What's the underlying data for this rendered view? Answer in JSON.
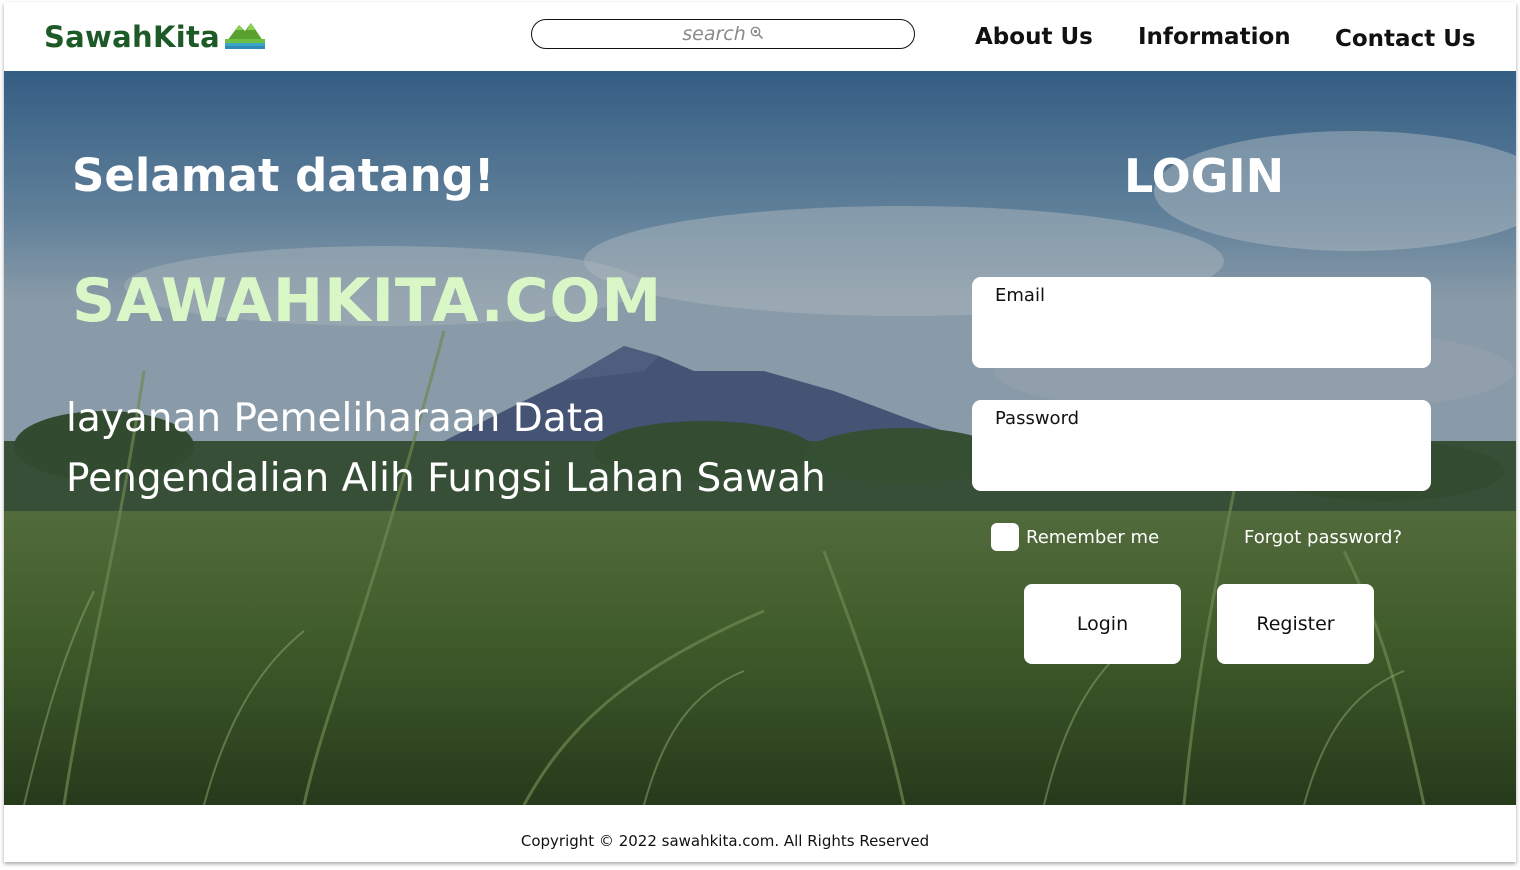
{
  "header": {
    "logo_text": "SawahKita",
    "search_placeholder": "search",
    "nav": [
      "About Us",
      "Information",
      "Contact Us"
    ]
  },
  "hero": {
    "welcome": "Selamat datang!",
    "brand": "SAWAHKITA.COM",
    "tagline_lines": [
      "layanan Pemeliharaan Data",
      "Pengendalian Alih Fungsi Lahan Sawah"
    ]
  },
  "login": {
    "title": "LOGIN",
    "email_label": "Email",
    "password_label": "Password",
    "remember_label": "Remember me",
    "forgot_label": "Forgot password?",
    "login_button": "Login",
    "register_button": "Register"
  },
  "footer": {
    "copyright": "Copyright © 2022 sawahkita.com. All Rights Reserved"
  },
  "colors": {
    "brand_green": "#1e5a27",
    "brand_light": "#d9f7c6"
  },
  "icons": {
    "logo": "rice-field-landscape-icon",
    "search": "search-icon"
  }
}
